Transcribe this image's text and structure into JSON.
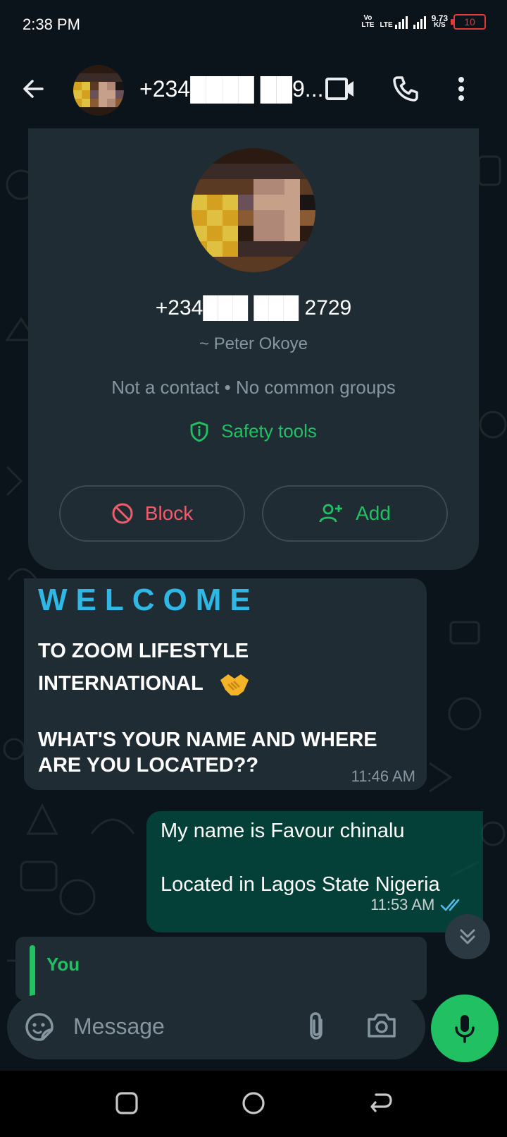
{
  "status_bar": {
    "time": "2:38 PM",
    "volte_top": "Vo",
    "volte_bottom": "LTE",
    "lte_label": "LTE",
    "net_speed_top": "9.73",
    "net_speed_bottom": "K/S",
    "battery": "10"
  },
  "header": {
    "title": "+234████ ██9...",
    "icons": [
      "back-arrow-icon",
      "video-call-icon",
      "phone-call-icon",
      "more-options-icon"
    ]
  },
  "info_card": {
    "phone": "+234███ ███ 2729",
    "display_name": "~ Peter Okoye",
    "meta": "Not a contact • No common groups",
    "safety_label": "Safety tools",
    "block_label": "Block",
    "add_label": "Add"
  },
  "messages": [
    {
      "direction": "incoming",
      "heading": "WELCOME",
      "line1": "TO ZOOM LIFESTYLE",
      "line2": "INTERNATIONAL",
      "line3": "WHAT'S YOUR NAME AND WHERE",
      "line4": "ARE YOU LOCATED??",
      "time": "11:46 AM"
    },
    {
      "direction": "outgoing",
      "line1": "My name is Favour chinalu",
      "line2": "Located in Lagos State Nigeria",
      "time": "11:53 AM",
      "status": "read"
    }
  ],
  "reply_preview": {
    "sender": "You"
  },
  "composer": {
    "placeholder": "Message"
  },
  "colors": {
    "background": "#0b141a",
    "bubble_in": "#202c33",
    "bubble_out": "#005c4b",
    "accent_green": "#21c063",
    "block_red": "#f15c6d",
    "welcome_blue": "#2fb8e6",
    "read_tick": "#53bdeb"
  }
}
